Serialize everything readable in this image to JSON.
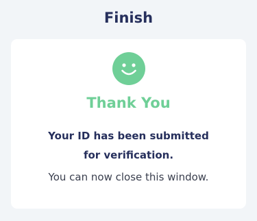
{
  "header": {
    "title": "Finish"
  },
  "card": {
    "icon": "smiley-face-icon",
    "heading": "Thank You",
    "message": "Your ID has been submitted for verification.",
    "note": "You can now close this window."
  },
  "colors": {
    "background": "#f2f5f8",
    "card": "#ffffff",
    "accent_green": "#6fcf97",
    "title_navy": "#262f5c",
    "body_text": "#3a3f4e"
  }
}
